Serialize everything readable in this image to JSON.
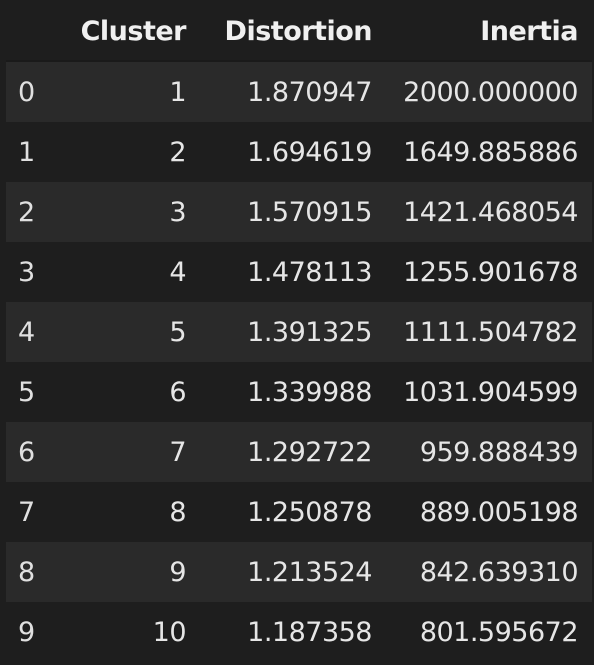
{
  "table": {
    "columns": [
      "",
      "Cluster",
      "Distortion",
      "Inertia"
    ],
    "rows": [
      {
        "index": "0",
        "cluster": "1",
        "distortion": "1.870947",
        "inertia": "2000.000000"
      },
      {
        "index": "1",
        "cluster": "2",
        "distortion": "1.694619",
        "inertia": "1649.885886"
      },
      {
        "index": "2",
        "cluster": "3",
        "distortion": "1.570915",
        "inertia": "1421.468054"
      },
      {
        "index": "3",
        "cluster": "4",
        "distortion": "1.478113",
        "inertia": "1255.901678"
      },
      {
        "index": "4",
        "cluster": "5",
        "distortion": "1.391325",
        "inertia": "1111.504782"
      },
      {
        "index": "5",
        "cluster": "6",
        "distortion": "1.339988",
        "inertia": "1031.904599"
      },
      {
        "index": "6",
        "cluster": "7",
        "distortion": "1.292722",
        "inertia": "959.888439"
      },
      {
        "index": "7",
        "cluster": "8",
        "distortion": "1.250878",
        "inertia": "889.005198"
      },
      {
        "index": "8",
        "cluster": "9",
        "distortion": "1.213524",
        "inertia": "842.639310"
      },
      {
        "index": "9",
        "cluster": "10",
        "distortion": "1.187358",
        "inertia": "801.595672"
      }
    ]
  }
}
